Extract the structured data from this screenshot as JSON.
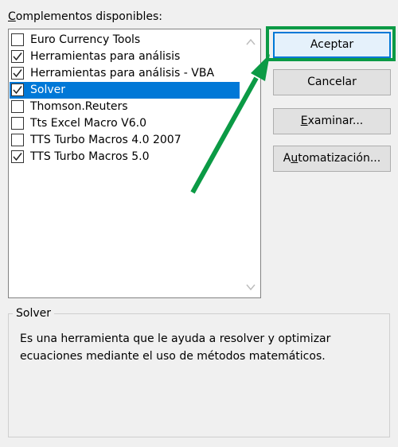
{
  "list": {
    "label_underlined": "C",
    "label_rest": "omplementos disponibles:",
    "items": [
      {
        "label": "Euro Currency Tools",
        "checked": false,
        "selected": false
      },
      {
        "label": "Herramientas para análisis",
        "checked": true,
        "selected": false
      },
      {
        "label": "Herramientas para análisis - VBA",
        "checked": true,
        "selected": false
      },
      {
        "label": "Solver",
        "checked": true,
        "selected": true
      },
      {
        "label": "Thomson.Reuters",
        "checked": false,
        "selected": false
      },
      {
        "label": "Tts Excel Macro V6.0",
        "checked": false,
        "selected": false
      },
      {
        "label": "TTS Turbo Macros 4.0 2007",
        "checked": false,
        "selected": false
      },
      {
        "label": "TTS Turbo Macros 5.0",
        "checked": true,
        "selected": false
      }
    ]
  },
  "buttons": {
    "accept": "Aceptar",
    "cancel": "Cancelar",
    "browse_underlined": "E",
    "browse_rest": "xaminar...",
    "automation_prefix": "A",
    "automation_underlined": "u",
    "automation_rest": "tomatización..."
  },
  "description": {
    "title": "Solver",
    "text": "Es una herramienta que le ayuda a resolver y optimizar ecuaciones mediante el uso de métodos matemáticos."
  },
  "colors": {
    "selection": "#0078d7",
    "annotation_green": "#0b9a45",
    "default_button_border": "#0078d7"
  }
}
